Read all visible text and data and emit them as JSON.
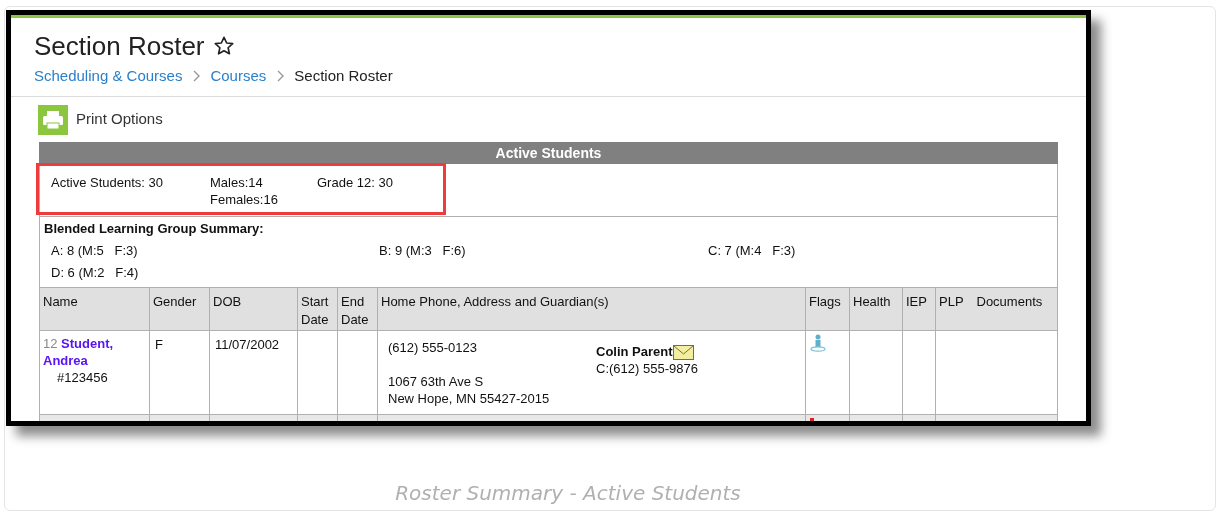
{
  "page": {
    "title": "Section Roster",
    "favorite": false
  },
  "breadcrumbs": [
    {
      "label": "Scheduling & Courses",
      "current": false
    },
    {
      "label": "Courses",
      "current": false
    },
    {
      "label": "Section Roster",
      "current": true
    }
  ],
  "print_button": "Print Options",
  "section_header": "Active Students",
  "summary": {
    "highlighted": true,
    "active_students": "Active Students: 30",
    "males": "Males:14",
    "females": "Females:16",
    "grade": "Grade 12: 30"
  },
  "blended": {
    "title": "Blended Learning Group Summary:",
    "groups": [
      "A: 8 (M:5   F:3)",
      "B: 9 (M:3   F:6)",
      "C: 7 (M:4   F:3)",
      "D: 6 (M:2   F:4)"
    ]
  },
  "table": {
    "columns": [
      "Name",
      "Gender",
      "DOB",
      "Start Date",
      "End Date",
      "Home Phone, Address and Guardian(s)",
      "Flags",
      "Health",
      "IEP",
      "PLP",
      "Documents"
    ],
    "rows": [
      {
        "grade": "12",
        "name": "Student, Andrea",
        "id": "#123456",
        "gender": "F",
        "dob": "11/07/2002",
        "phone": "(612) 555-0123",
        "address_lines": [
          "1067 63th Ave S",
          "New Hope, MN 55427-2015"
        ],
        "guardian": {
          "name": "Colin Parent",
          "email": true,
          "phone": "C:(612) 555-9876"
        },
        "flags": [
          {
            "kind": "person"
          }
        ]
      },
      {
        "flags": [
          {
            "kind": "alert"
          }
        ]
      }
    ]
  },
  "caption": "Roster Summary - Active Students"
}
